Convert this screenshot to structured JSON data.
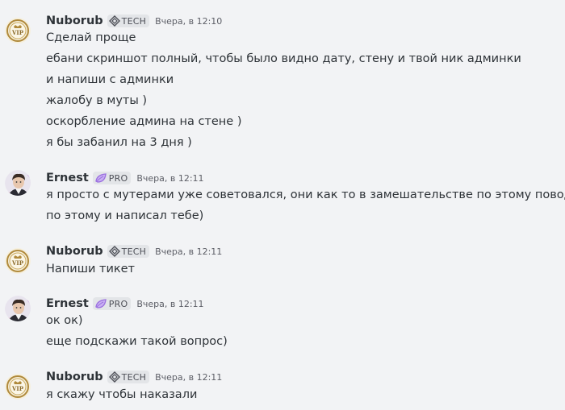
{
  "messages": [
    {
      "author": "Nuborub",
      "tag": "TECH",
      "time": "Вчера, в 12:10",
      "lines": [
        "Сделай проще",
        "ебани скриншот полный, чтобы было видно дату, стену и твой ник админки",
        "и напиши с админки",
        "жалобу в муты )",
        "оскорбление админа на стене )",
        "я бы забанил на 3 дня )"
      ]
    },
    {
      "author": "Ernest",
      "tag": "PRO",
      "time": "Вчера, в 12:11",
      "lines": [
        "я просто с мутерами уже советовался, они как то в замешательстве по этому поводу)",
        "по этому и написал тебе)"
      ]
    },
    {
      "author": "Nuborub",
      "tag": "TECH",
      "time": "Вчера, в 12:11",
      "lines": [
        "Напиши тикет"
      ]
    },
    {
      "author": "Ernest",
      "tag": "PRO",
      "time": "Вчера, в 12:11",
      "lines": [
        "ок ок)",
        "еще подскажи такой вопрос)"
      ]
    },
    {
      "author": "Nuborub",
      "tag": "TECH",
      "time": "Вчера, в 12:11",
      "lines": [
        "я скажу чтобы наказали"
      ]
    }
  ],
  "avatars": {
    "vip_badge_text": "VIP"
  },
  "colors": {
    "background": "#f2f3f5",
    "text": "#2e3338",
    "timestamp": "#5c5e66",
    "tag_bg": "#e3e5e8",
    "pro_purple": "#9b6fe0",
    "vip_gold": "#b08a3c"
  }
}
